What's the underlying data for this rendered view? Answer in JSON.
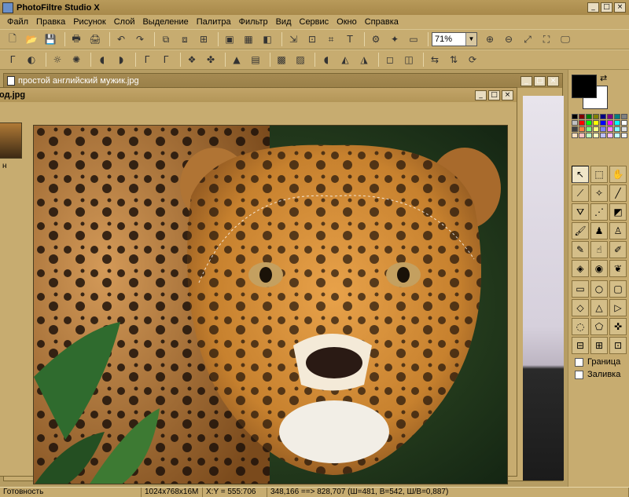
{
  "app": {
    "title": "PhotoFiltre Studio X"
  },
  "window_controls": {
    "minimize": "_",
    "maximize": "□",
    "close": "×"
  },
  "menu": [
    {
      "label": "Файл"
    },
    {
      "label": "Правка"
    },
    {
      "label": "Рисунок"
    },
    {
      "label": "Слой"
    },
    {
      "label": "Выделение"
    },
    {
      "label": "Палитра"
    },
    {
      "label": "Фильтр"
    },
    {
      "label": "Вид"
    },
    {
      "label": "Сервис"
    },
    {
      "label": "Окно"
    },
    {
      "label": "Справка"
    }
  ],
  "toolbar": {
    "zoom_value": "71%",
    "zoom_arrow": "▼",
    "row1": [
      {
        "name": "new-icon",
        "glyph": "🗋"
      },
      {
        "name": "open-icon",
        "glyph": "📂"
      },
      {
        "name": "save-icon",
        "glyph": "💾"
      },
      {
        "name": "sep"
      },
      {
        "name": "print-icon",
        "glyph": "🖶"
      },
      {
        "name": "scan-icon",
        "glyph": "🖨"
      },
      {
        "name": "sep"
      },
      {
        "name": "undo-icon",
        "glyph": "↶"
      },
      {
        "name": "redo-icon",
        "glyph": "↷"
      },
      {
        "name": "sep"
      },
      {
        "name": "copy-image-icon",
        "glyph": "⧉"
      },
      {
        "name": "paste-image-icon",
        "glyph": "⧈"
      },
      {
        "name": "paste-new-icon",
        "glyph": "⊞"
      },
      {
        "name": "sep"
      },
      {
        "name": "layer-icon",
        "glyph": "▣"
      },
      {
        "name": "colors-icon",
        "glyph": "▦"
      },
      {
        "name": "mask-icon",
        "glyph": "◧"
      },
      {
        "name": "sep"
      },
      {
        "name": "image-size-icon",
        "glyph": "⇲"
      },
      {
        "name": "canvas-size-icon",
        "glyph": "⊡"
      },
      {
        "name": "crop-icon",
        "glyph": "⌗"
      },
      {
        "name": "text-icon",
        "glyph": "T"
      },
      {
        "name": "sep"
      },
      {
        "name": "plugin-icon",
        "glyph": "⚙"
      },
      {
        "name": "automate-icon",
        "glyph": "✦"
      },
      {
        "name": "browser-icon",
        "glyph": "▭"
      }
    ],
    "row1_tail": [
      {
        "name": "zoom-in-icon",
        "glyph": "⊕"
      },
      {
        "name": "zoom-out-icon",
        "glyph": "⊖"
      },
      {
        "name": "fit-window-icon",
        "glyph": "⤢"
      },
      {
        "name": "actual-size-icon",
        "glyph": "⛶"
      },
      {
        "name": "fullscreen-icon",
        "glyph": "🖵"
      }
    ],
    "row2": [
      {
        "name": "auto-levels-icon",
        "glyph": "Γ"
      },
      {
        "name": "auto-contrast-icon",
        "glyph": "◐"
      },
      {
        "name": "sep"
      },
      {
        "name": "brightness-plus-icon",
        "glyph": "☼"
      },
      {
        "name": "brightness-minus-icon",
        "glyph": "✺"
      },
      {
        "name": "sep"
      },
      {
        "name": "contrast-plus-icon",
        "glyph": "◖"
      },
      {
        "name": "contrast-minus-icon",
        "glyph": "◗"
      },
      {
        "name": "sep"
      },
      {
        "name": "gamma-plus-icon",
        "glyph": "Γ"
      },
      {
        "name": "gamma-minus-icon",
        "glyph": "Γ"
      },
      {
        "name": "sep"
      },
      {
        "name": "saturation-icon",
        "glyph": "❖"
      },
      {
        "name": "hue-icon",
        "glyph": "✤"
      },
      {
        "name": "sep"
      },
      {
        "name": "grayscale-icon",
        "glyph": "▲"
      },
      {
        "name": "sepia-icon",
        "glyph": "▤"
      },
      {
        "name": "sep"
      },
      {
        "name": "blur-icon",
        "glyph": "▩"
      },
      {
        "name": "sharpen-icon",
        "glyph": "▨"
      },
      {
        "name": "sep"
      },
      {
        "name": "soften-icon",
        "glyph": "◖"
      },
      {
        "name": "drop-icon",
        "glyph": "◭"
      },
      {
        "name": "drop2-icon",
        "glyph": "◮"
      },
      {
        "name": "sep"
      },
      {
        "name": "texture-icon",
        "glyph": "◻"
      },
      {
        "name": "stretch-icon",
        "glyph": "◫"
      },
      {
        "name": "sep"
      },
      {
        "name": "flip-h-icon",
        "glyph": "⇆"
      },
      {
        "name": "flip-v-icon",
        "glyph": "⇅"
      },
      {
        "name": "rotate-icon",
        "glyph": "⟳"
      }
    ]
  },
  "documents": {
    "back_title": "простой английский мужик.jpg",
    "front_title": "од.jpg",
    "thumb_label": "н"
  },
  "palette_colors": [
    "#000000",
    "#800000",
    "#008000",
    "#808000",
    "#000080",
    "#800080",
    "#008080",
    "#808080",
    "#c0c0c0",
    "#ff0000",
    "#00ff00",
    "#ffff00",
    "#0000ff",
    "#ff00ff",
    "#00ffff",
    "#ffffff",
    "#404040",
    "#ff8040",
    "#80ff80",
    "#ffff80",
    "#8080ff",
    "#ff80ff",
    "#80ffff",
    "#e0e0e0",
    "#ffe0c0",
    "#ffc0c0",
    "#c0ffc0",
    "#ffffc0",
    "#c0c0ff",
    "#ffc0ff",
    "#c0ffff",
    "#f0f0f0"
  ],
  "tools": [
    {
      "name": "select-tool-icon",
      "glyph": "↖"
    },
    {
      "name": "magic-select-icon",
      "glyph": "⬚"
    },
    {
      "name": "hand-tool-icon",
      "glyph": "✋"
    },
    {
      "name": "eyedropper-icon",
      "glyph": "⟋"
    },
    {
      "name": "magic-wand-icon",
      "glyph": "✧"
    },
    {
      "name": "line-tool-icon",
      "glyph": "╱"
    },
    {
      "name": "fill-bucket-icon",
      "glyph": "⛛"
    },
    {
      "name": "spray-icon",
      "glyph": "⋰"
    },
    {
      "name": "eraser-icon",
      "glyph": "◩"
    },
    {
      "name": "brush-icon",
      "glyph": "🖌"
    },
    {
      "name": "clone-stamp-icon",
      "glyph": "♟"
    },
    {
      "name": "pattern-stamp-icon",
      "glyph": "♙"
    },
    {
      "name": "pencil-icon",
      "glyph": "✎"
    },
    {
      "name": "finger-icon",
      "glyph": "☝"
    },
    {
      "name": "retouch-icon",
      "glyph": "✐"
    },
    {
      "name": "blur-tool-icon",
      "glyph": "◈"
    },
    {
      "name": "red-eye-icon",
      "glyph": "◉"
    },
    {
      "name": "strawberry-icon",
      "glyph": "❦"
    }
  ],
  "shapes": [
    {
      "name": "rect-shape-icon",
      "glyph": "▭"
    },
    {
      "name": "ellipse-shape-icon",
      "glyph": "○"
    },
    {
      "name": "rounded-rect-icon",
      "glyph": "▢"
    },
    {
      "name": "diamond-shape-icon",
      "glyph": "◇"
    },
    {
      "name": "triangle-shape-icon",
      "glyph": "△"
    },
    {
      "name": "arrow-shape-icon",
      "glyph": "▷"
    },
    {
      "name": "lasso-icon",
      "glyph": "◌"
    },
    {
      "name": "polygon-icon",
      "glyph": "⬠"
    },
    {
      "name": "magic-poly-icon",
      "glyph": "✜"
    },
    {
      "name": "invert-selection-icon",
      "glyph": "⊟"
    },
    {
      "name": "grid-selection-icon",
      "glyph": "⊞"
    },
    {
      "name": "all-selection-icon",
      "glyph": "⊡"
    }
  ],
  "options": {
    "border_label": "Граница",
    "fill_label": "Заливка"
  },
  "status": {
    "ready": "Готовность",
    "size": "1024x768x16M",
    "coords": "X:Y = 555:706",
    "selection": "348,166 ==> 828,707 (Ш=481, В=542, Ш/В=0,887)"
  },
  "colors": {
    "foreground": "#000000",
    "background": "#ffffff",
    "accent": "#c7ac70"
  }
}
